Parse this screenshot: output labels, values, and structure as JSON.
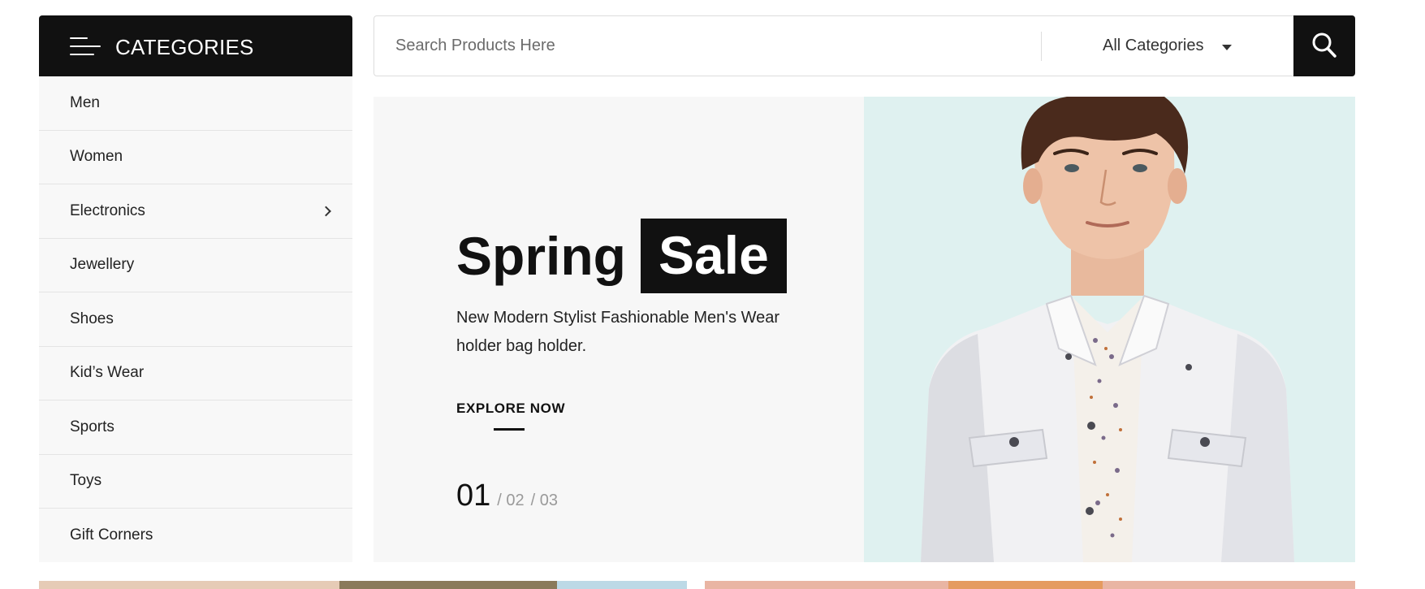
{
  "categories": {
    "title": "CATEGORIES",
    "items": [
      {
        "label": "Men"
      },
      {
        "label": "Women"
      },
      {
        "label": "Electronics",
        "has_submenu": true
      },
      {
        "label": "Jewellery"
      },
      {
        "label": "Shoes"
      },
      {
        "label": "Kid’s Wear"
      },
      {
        "label": "Sports"
      },
      {
        "label": "Toys"
      },
      {
        "label": "Gift Corners"
      }
    ]
  },
  "search": {
    "placeholder": "Search Products Here",
    "value": "",
    "category_selected": "All Categories",
    "button_icon": "search-icon"
  },
  "hero": {
    "title_word": "Spring",
    "title_highlight": "Sale",
    "description": "New Modern Stylist Fashionable Men's Wear holder bag holder.",
    "cta_label": "EXPLORE NOW",
    "slide_current": "01",
    "slide_others": [
      "/ 02",
      "/ 03"
    ],
    "photo_background": "#dff1f0"
  },
  "colors": {
    "dark": "#111111",
    "sidebar_bg": "#f8f8f8",
    "hero_bg": "#f7f7f7",
    "muted_text": "#9a9a9a"
  }
}
